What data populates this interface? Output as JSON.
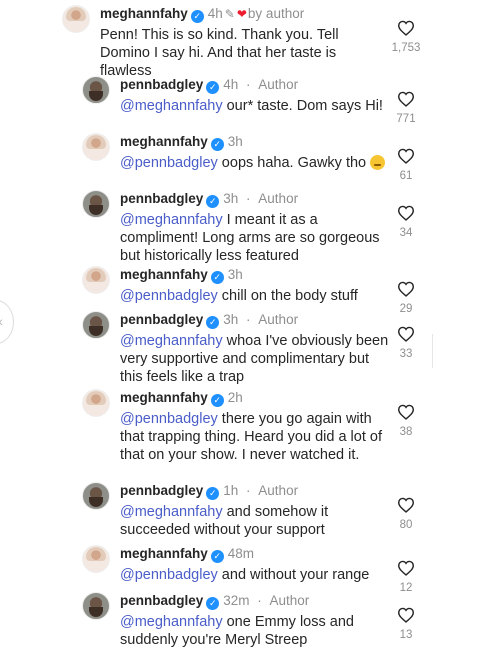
{
  "comments": [
    {
      "user": "meghannfahy",
      "avatar": "meg",
      "time": "4h",
      "pinned": true,
      "liked_by_author": true,
      "by_author_text": "by author",
      "body": "Penn! This is so kind. Thank you. Tell Domino I say hi. And that her taste is flawless",
      "mention": "",
      "likes": "1,753",
      "emoji": false
    },
    {
      "user": "pennbadgley",
      "avatar": "penn",
      "time": "4h",
      "author": "Author",
      "mention": "@meghannfahy",
      "body": " our* taste. Dom says Hi!",
      "likes": "771",
      "emoji": false
    },
    {
      "user": "meghannfahy",
      "avatar": "meg",
      "time": "3h",
      "mention": "@pennbadgley",
      "body": " oops haha. Gawky tho",
      "likes": "61",
      "emoji": true
    },
    {
      "user": "pennbadgley",
      "avatar": "penn",
      "time": "3h",
      "author": "Author",
      "mention": "@meghannfahy",
      "body": " I meant it as a compliment! Long arms are so gorgeous but historically less featured",
      "likes": "34",
      "emoji": false
    },
    {
      "user": "meghannfahy",
      "avatar": "meg",
      "time": "3h",
      "mention": "@pennbadgley",
      "body": " chill on the body stuff",
      "likes": "29",
      "emoji": false
    },
    {
      "user": "pennbadgley",
      "avatar": "penn",
      "time": "3h",
      "author": "Author",
      "mention": "@meghannfahy",
      "body": " whoa I've obviously been very supportive and complimentary but this feels like a trap",
      "likes": "33",
      "emoji": false
    },
    {
      "user": "meghannfahy",
      "avatar": "meg",
      "time": "2h",
      "mention": "@pennbadgley",
      "body": " there you go again with that trapping thing. Heard you did a lot of that on your show. I never watched it.",
      "likes": "38",
      "emoji": false
    },
    {
      "user": "pennbadgley",
      "avatar": "penn",
      "time": "1h",
      "author": "Author",
      "mention": "@meghannfahy",
      "body": " and somehow it succeeded without your support",
      "likes": "80",
      "emoji": false
    },
    {
      "user": "meghannfahy",
      "avatar": "meg",
      "time": "48m",
      "mention": "@pennbadgley",
      "body": " and without your range",
      "likes": "12",
      "emoji": false
    },
    {
      "user": "pennbadgley",
      "avatar": "penn",
      "time": "32m",
      "author": "Author",
      "mention": "@meghannfahy",
      "body": " one Emmy loss and suddenly you're Meryl Streep",
      "likes": "13",
      "emoji": false
    }
  ],
  "colors": {
    "mention": "#4a5dc9",
    "verified": "#1e90ff",
    "heart": "#ed1c2e",
    "meta": "#8e8e8e"
  },
  "icons": {
    "verified": "verified-badge-icon",
    "pin": "pin-icon",
    "author_heart": "heart-filled-icon",
    "like": "heart-outline-icon"
  }
}
